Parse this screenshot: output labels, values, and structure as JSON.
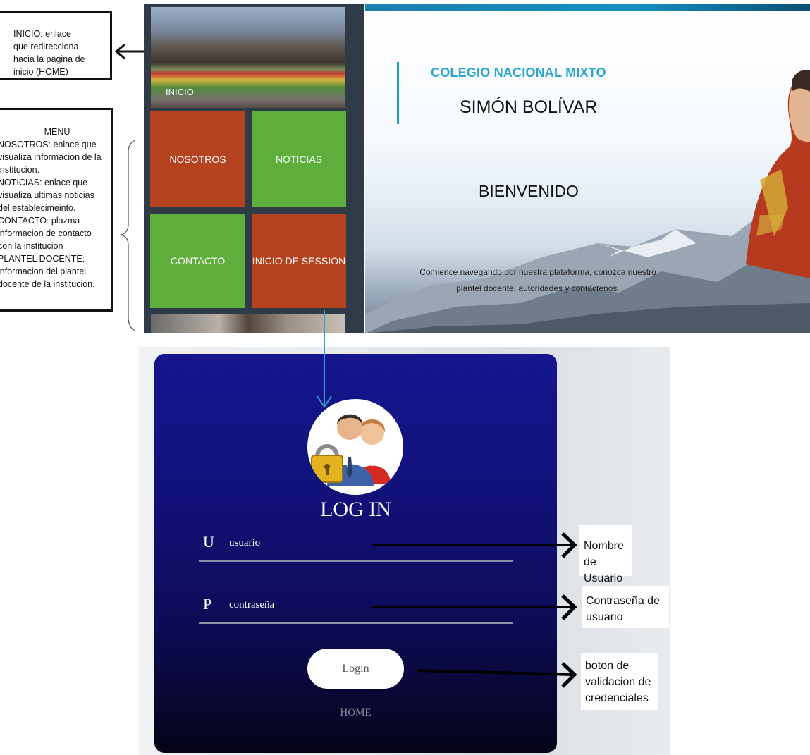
{
  "annotations": {
    "inicio_note": [
      "INICIO: enlace",
      "que redirecciona",
      "hacia la pagina de",
      "inicio (HOME)"
    ],
    "menu_note": {
      "title": "MENU",
      "lines": [
        "NOSOTROS: enlace que",
        "visualiza informacion de la",
        "institucion.",
        "NOTICIAS: enlace que",
        "visualiza ultimas noticias",
        "del establecimeinto.",
        "CONTACTO: plazma",
        "informacion de contacto",
        "con la institucion",
        "PLANTEL DOCENTE:",
        "informacion del plantel",
        "docente de la institucion."
      ]
    },
    "username_note": [
      "Nombre de",
      "Usuario"
    ],
    "password_note": [
      "Contraseña de",
      "usuario"
    ],
    "button_note": [
      "boton de",
      "validacion de",
      "credenciales"
    ]
  },
  "tiles": {
    "inicio": "INICIO",
    "nosotros": "NOSOTROS",
    "noticias": "NOTICIAS",
    "contacto": "CONTACTO",
    "sesion": "INICIO DE SESSION"
  },
  "hero": {
    "college": "COLEGIO NACIONAL MIXTO",
    "name": "SIMÓN BOLÍVAR",
    "welcome": "BIENVENIDO",
    "description_line1": "Comience navegando por nuestra plataforma, conozca nuestro",
    "description_line2": "plantel docente, autoridades y contáctenos."
  },
  "login": {
    "title": "LOG IN",
    "user_letter": "U",
    "user_placeholder": "usuario",
    "pass_letter": "P",
    "pass_placeholder": "contraseña",
    "button_label": "Login",
    "home_link": "HOME"
  },
  "colors": {
    "tile_red": "#b5431f",
    "tile_green": "#5eae3b",
    "accent_blue": "#2aa6cd",
    "card_blue": "#15168f"
  }
}
